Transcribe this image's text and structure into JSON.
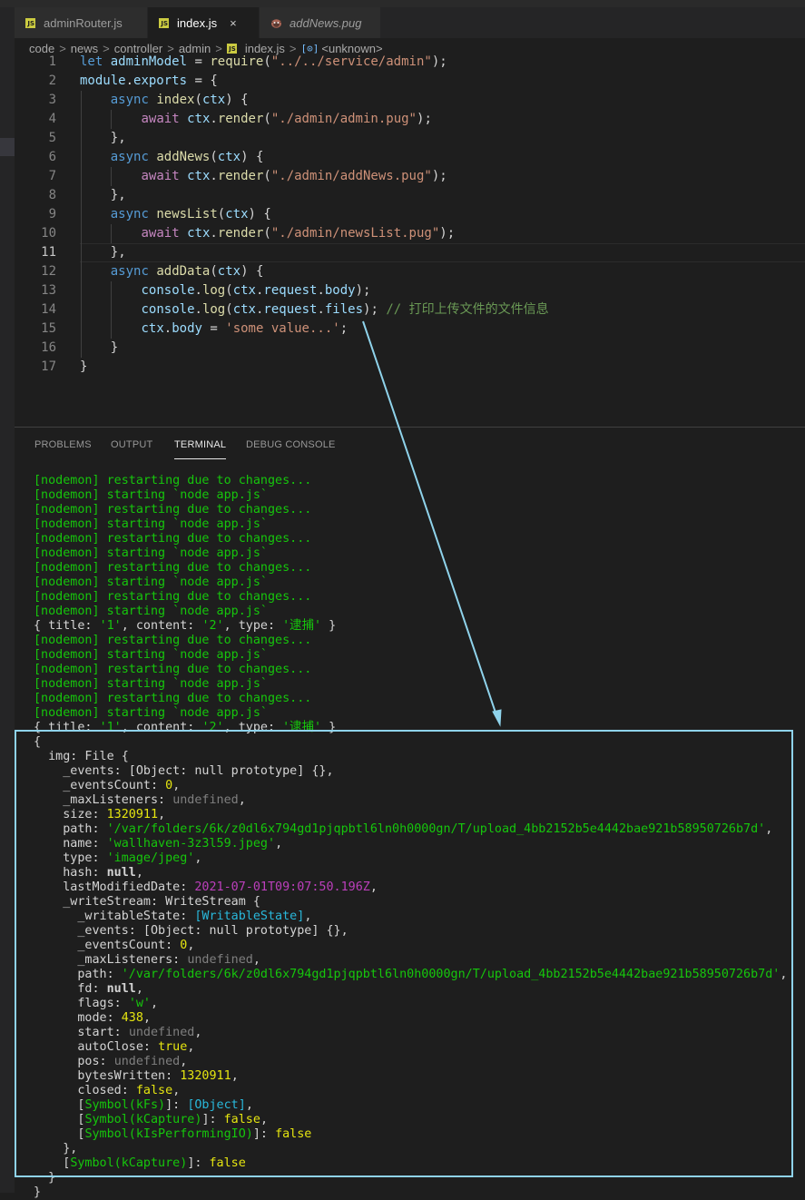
{
  "tabs": [
    {
      "label": "adminRouter.js",
      "icon": "js-icon",
      "active": false
    },
    {
      "label": "index.js",
      "icon": "js-icon",
      "active": true
    },
    {
      "label": "addNews.pug",
      "icon": "pug-icon",
      "active": false
    }
  ],
  "tab_close_glyph": "×",
  "breadcrumb": {
    "parts": [
      "code",
      "news",
      "controller",
      "admin",
      "index.js",
      "<unknown>"
    ],
    "separator": ">",
    "symbol_icon": "symbol-variable-icon"
  },
  "editor": {
    "current_line": 11,
    "lines": [
      {
        "n": "1",
        "text": "let adminModel = require(\"../../service/admin\");"
      },
      {
        "n": "2",
        "text": "module.exports = {"
      },
      {
        "n": "3",
        "text": "    async index(ctx) {"
      },
      {
        "n": "4",
        "text": "        await ctx.render(\"./admin/admin.pug\");"
      },
      {
        "n": "5",
        "text": "    },"
      },
      {
        "n": "6",
        "text": "    async addNews(ctx) {"
      },
      {
        "n": "7",
        "text": "        await ctx.render(\"./admin/addNews.pug\");"
      },
      {
        "n": "8",
        "text": "    },"
      },
      {
        "n": "9",
        "text": "    async newsList(ctx) {"
      },
      {
        "n": "10",
        "text": "        await ctx.render(\"./admin/newsList.pug\");"
      },
      {
        "n": "11",
        "text": "    },"
      },
      {
        "n": "12",
        "text": "    async addData(ctx) {"
      },
      {
        "n": "13",
        "text": "        console.log(ctx.request.body);"
      },
      {
        "n": "14",
        "text": "        console.log(ctx.request.files); // 打印上传文件的文件信息"
      },
      {
        "n": "15",
        "text": "        ctx.body = 'some value...';"
      },
      {
        "n": "16",
        "text": "    }"
      },
      {
        "n": "17",
        "text": "}"
      }
    ]
  },
  "panel_tabs": [
    {
      "label": "PROBLEMS",
      "active": false
    },
    {
      "label": "OUTPUT",
      "active": false
    },
    {
      "label": "TERMINAL",
      "active": true
    },
    {
      "label": "DEBUG CONSOLE",
      "active": false
    }
  ],
  "terminal": {
    "lines": [
      "[nodemon] restarting due to changes...",
      "[nodemon] starting `node app.js`",
      "[nodemon] restarting due to changes...",
      "[nodemon] starting `node app.js`",
      "[nodemon] restarting due to changes...",
      "[nodemon] starting `node app.js`",
      "[nodemon] restarting due to changes...",
      "[nodemon] starting `node app.js`",
      "[nodemon] restarting due to changes...",
      "[nodemon] starting `node app.js`",
      "{ title: '1', content: '2', type: '逮捕' }",
      "[nodemon] restarting due to changes...",
      "[nodemon] starting `node app.js`",
      "[nodemon] restarting due to changes...",
      "[nodemon] starting `node app.js`",
      "[nodemon] restarting due to changes...",
      "[nodemon] starting `node app.js`",
      "{ title: '1', content: '2', type: '逮捕' }",
      "{",
      "  img: File {",
      "    _events: [Object: null prototype] {},",
      "    _eventsCount: 0,",
      "    _maxListeners: undefined,",
      "    size: 1320911,",
      "    path: '/var/folders/6k/z0dl6x794gd1pjqpbtl6ln0h0000gn/T/upload_4bb2152b5e4442bae921b58950726b7d',",
      "    name: 'wallhaven-3z3l59.jpeg',",
      "    type: 'image/jpeg',",
      "    hash: null,",
      "    lastModifiedDate: 2021-07-01T09:07:50.196Z,",
      "    _writeStream: WriteStream {",
      "      _writableState: [WritableState],",
      "      _events: [Object: null prototype] {},",
      "      _eventsCount: 0,",
      "      _maxListeners: undefined,",
      "      path: '/var/folders/6k/z0dl6x794gd1pjqpbtl6ln0h0000gn/T/upload_4bb2152b5e4442bae921b58950726b7d',",
      "      fd: null,",
      "      flags: 'w',",
      "      mode: 438,",
      "      start: undefined,",
      "      autoClose: true,",
      "      pos: undefined,",
      "      bytesWritten: 1320911,",
      "      closed: false,",
      "      [Symbol(kFs)]: [Object],",
      "      [Symbol(kCapture)]: false,",
      "      [Symbol(kIsPerformingIO)]: false",
      "    },",
      "    [Symbol(kCapture)]: false",
      "  }",
      "}"
    ]
  },
  "colors": {
    "annotation_box": "#8fd3eb",
    "terminal_green": "#16c60c",
    "terminal_yellow": "#e5e510",
    "terminal_magenta": "#bc3fbc",
    "terminal_cyan": "#29b8db",
    "editor_background": "#1e1e1e"
  }
}
